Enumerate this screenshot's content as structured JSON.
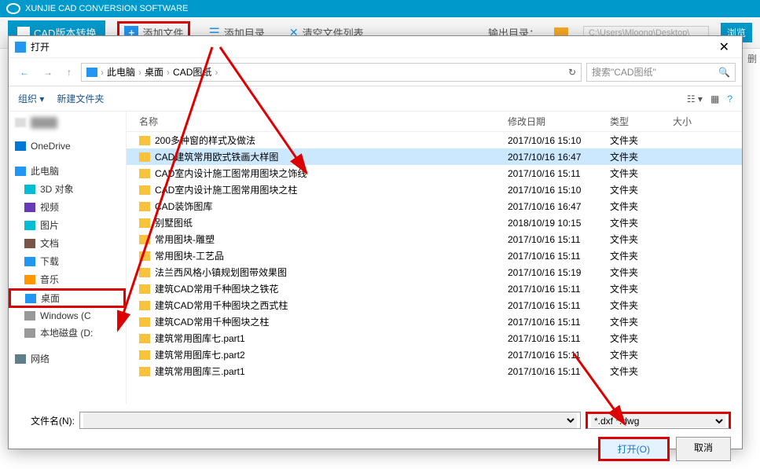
{
  "app": {
    "title": "XUNJIE CAD CONVERSION SOFTWARE",
    "tab_label": "CAD版本转换",
    "toolbar": {
      "add_file": "添加文件",
      "add_dir": "添加目录",
      "clear_list": "清空文件列表",
      "output_label": "输出目录：",
      "output_path": "C:\\Users\\Mloong\\Desktop\\",
      "browse": "浏览",
      "delete": "删"
    }
  },
  "dialog": {
    "title": "打开",
    "breadcrumb": {
      "thispc": "此电脑",
      "desktop": "桌面",
      "folder": "CAD图纸"
    },
    "search_placeholder": "搜索\"CAD图纸\"",
    "organize": "组织",
    "new_folder": "新建文件夹",
    "columns": {
      "name": "名称",
      "date": "修改日期",
      "type": "类型",
      "size": "大小"
    },
    "sidebar": {
      "onedrive": "OneDrive",
      "thispc": "此电脑",
      "obj3d": "3D 对象",
      "video": "视频",
      "pictures": "图片",
      "documents": "文档",
      "downloads": "下载",
      "music": "音乐",
      "desktop": "桌面",
      "windowsc": "Windows (C",
      "localdisk": "本地磁盘 (D:",
      "network": "网络"
    },
    "files": [
      {
        "name": "200多种窗的样式及做法",
        "date": "2017/10/16 15:10",
        "type": "文件夹"
      },
      {
        "name": "CAD建筑常用欧式铁画大样图",
        "date": "2017/10/16 16:47",
        "type": "文件夹",
        "selected": true
      },
      {
        "name": "CAD室内设计施工图常用图块之饰线",
        "date": "2017/10/16 15:11",
        "type": "文件夹"
      },
      {
        "name": "CAD室内设计施工图常用图块之柱",
        "date": "2017/10/16 15:10",
        "type": "文件夹"
      },
      {
        "name": "CAD装饰图库",
        "date": "2017/10/16 16:47",
        "type": "文件夹"
      },
      {
        "name": "别墅图纸",
        "date": "2018/10/19 10:15",
        "type": "文件夹"
      },
      {
        "name": "常用图块-雕塑",
        "date": "2017/10/16 15:11",
        "type": "文件夹"
      },
      {
        "name": "常用图块-工艺品",
        "date": "2017/10/16 15:11",
        "type": "文件夹"
      },
      {
        "name": "法兰西风格小镇规划图带效果图",
        "date": "2017/10/16 15:19",
        "type": "文件夹"
      },
      {
        "name": "建筑CAD常用千种图块之铁花",
        "date": "2017/10/16 15:11",
        "type": "文件夹"
      },
      {
        "name": "建筑CAD常用千种图块之西式柱",
        "date": "2017/10/16 15:11",
        "type": "文件夹"
      },
      {
        "name": "建筑CAD常用千种图块之柱",
        "date": "2017/10/16 15:11",
        "type": "文件夹"
      },
      {
        "name": "建筑常用图库七.part1",
        "date": "2017/10/16 15:11",
        "type": "文件夹"
      },
      {
        "name": "建筑常用图库七.part2",
        "date": "2017/10/16 15:11",
        "type": "文件夹"
      },
      {
        "name": "建筑常用图库三.part1",
        "date": "2017/10/16 15:11",
        "type": "文件夹"
      }
    ],
    "filename_label": "文件名(N):",
    "filetype": "*.dxf *.dwg",
    "open_btn": "打开(O)",
    "cancel_btn": "取消"
  }
}
